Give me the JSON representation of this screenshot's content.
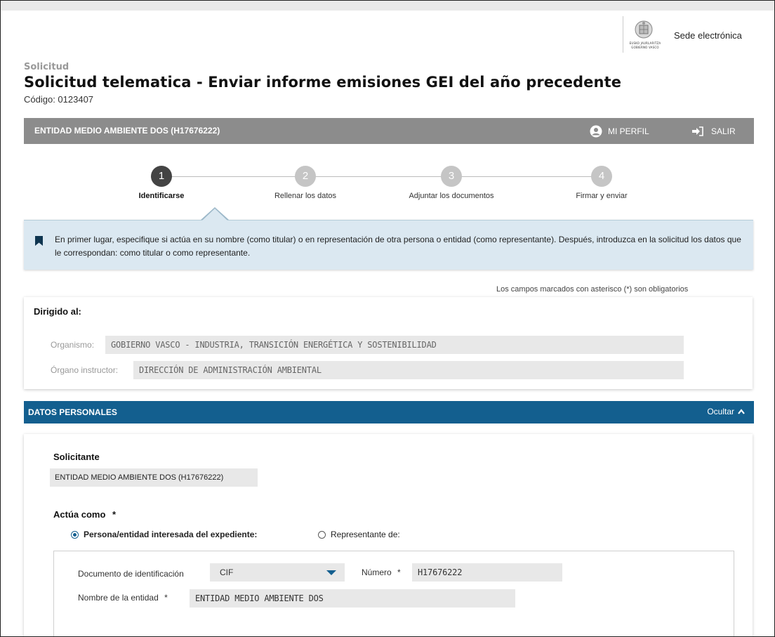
{
  "header": {
    "logo_text": [
      "EUSKO JAURLARITZA",
      "GOBIERNO VASCO"
    ],
    "sede_label": "Sede electrónica"
  },
  "page": {
    "kicker": "Solicitud",
    "title": "Solicitud telematica - Enviar informe emisiones GEI del año precedente",
    "code": "Código: 0123407"
  },
  "userbar": {
    "entity": "ENTIDAD MEDIO AMBIENTE DOS (H17676222)",
    "profile_label": "MI PERFIL",
    "logout_label": "SALIR"
  },
  "steps": [
    {
      "number": "1",
      "label": "Identificarse",
      "active": true
    },
    {
      "number": "2",
      "label": "Rellenar los datos",
      "active": false
    },
    {
      "number": "3",
      "label": "Adjuntar los documentos",
      "active": false
    },
    {
      "number": "4",
      "label": "Firmar y enviar",
      "active": false
    }
  ],
  "info": {
    "text": "En primer lugar, especifique si actúa en su nombre (como titular) o en representación de otra persona o entidad (como representante). Después, introduzca en la solicitud los datos que le correspondan: como titular o como representante."
  },
  "required_note": "Los campos marcados con asterisco (*) son obligatorios",
  "dirigido": {
    "title": "Dirigido al:",
    "organismo_label": "Organismo:",
    "organismo_value": "GOBIERNO VASCO - INDUSTRIA, TRANSICIÓN ENERGÉTICA Y SOSTENIBILIDAD",
    "organo_label": "Órgano instructor:",
    "organo_value": "DIRECCIÓN DE ADMINISTRACIÓN AMBIENTAL"
  },
  "datos_personales": {
    "title": "DATOS PERSONALES",
    "toggle_label": "Ocultar",
    "solicitante_label": "Solicitante",
    "solicitante_value": "ENTIDAD MEDIO AMBIENTE DOS (H17676222)",
    "actua_label": "Actúa como",
    "required_mark": "*",
    "option_interesada": "Persona/entidad interesada del expediente:",
    "option_representante": "Representante de:",
    "selected_option": "interesada",
    "doc_label": "Documento de identificación",
    "doc_value": "CIF",
    "numero_label": "Número",
    "numero_value": "H17676222",
    "nombre_label": "Nombre de la entidad",
    "nombre_value": "ENTIDAD MEDIO AMBIENTE DOS"
  },
  "colors": {
    "section_blue": "#135f8f",
    "info_bg": "#dbe8f1",
    "userbar_grey": "#8c8c8c",
    "active_step": "#444444"
  }
}
